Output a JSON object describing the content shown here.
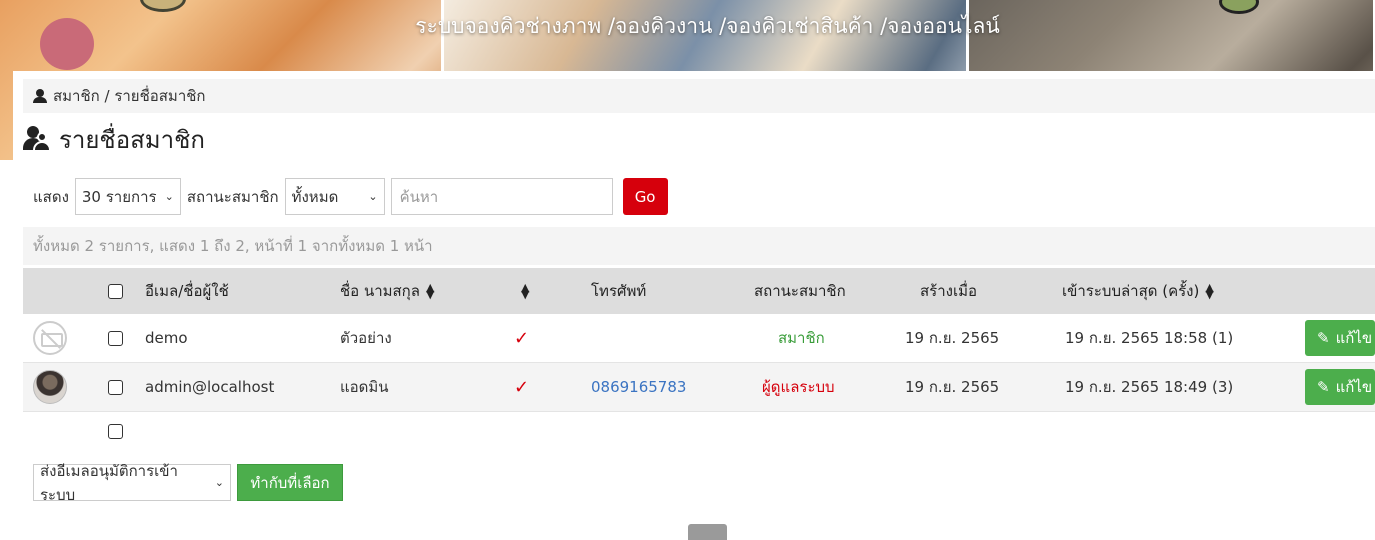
{
  "header": {
    "title": "ระบบจองคิวช่างภาพ /จองคิวงาน /จองคิวเช่าสินค้า /จองออนไลน์"
  },
  "breadcrumb": {
    "text": "สมาชิก / รายชื่อสมาชิก"
  },
  "page": {
    "title": "รายชื่อสมาชิก"
  },
  "filters": {
    "show_label": "แสดง",
    "show_value": "30 รายการ",
    "status_label": "สถานะสมาชิก",
    "status_value": "ทั้งหมด",
    "search_placeholder": "ค้นหา",
    "go_label": "Go"
  },
  "summary": "ทั้งหมด 2 รายการ, แสดง 1 ถึง 2, หน้าที่ 1 จากทั้งหมด 1 หน้า",
  "table": {
    "columns": {
      "email": "อีเมล/ชื่อผู้ใช้",
      "name": "ชื่อ นามสกุล",
      "active": "",
      "phone": "โทรศัพท์",
      "status": "สถานะสมาชิก",
      "created": "สร้างเมื่อ",
      "last_login": "เข้าระบบล่าสุด (ครั้ง)"
    },
    "sort_icon": "▲▼",
    "check_glyph": "✓",
    "edit_label": "แก้ไข",
    "rows": [
      {
        "avatar": "no-image-icon",
        "email": "demo",
        "name": "ตัวอย่าง",
        "active": true,
        "phone": "",
        "status": "สมาชิก",
        "created": "19 ก.ย. 2565",
        "last_login": "19 ก.ย. 2565 18:58 (1)"
      },
      {
        "avatar": "user-photo",
        "email": "admin@localhost",
        "name": "แอดมิน",
        "active": true,
        "phone": "0869165783",
        "status": "ผู้ดูแลระบบ",
        "created": "19 ก.ย. 2565",
        "last_login": "19 ก.ย. 2565 18:49 (3)"
      }
    ]
  },
  "bulk": {
    "action_value": "ส่งอีเมลอนุมัติการเข้าระบบ",
    "apply_label": "ทำกับที่เลือก"
  },
  "colors": {
    "accent_red": "#d6000c",
    "success_green": "#4cae4c",
    "link_blue": "#3b74c2"
  }
}
